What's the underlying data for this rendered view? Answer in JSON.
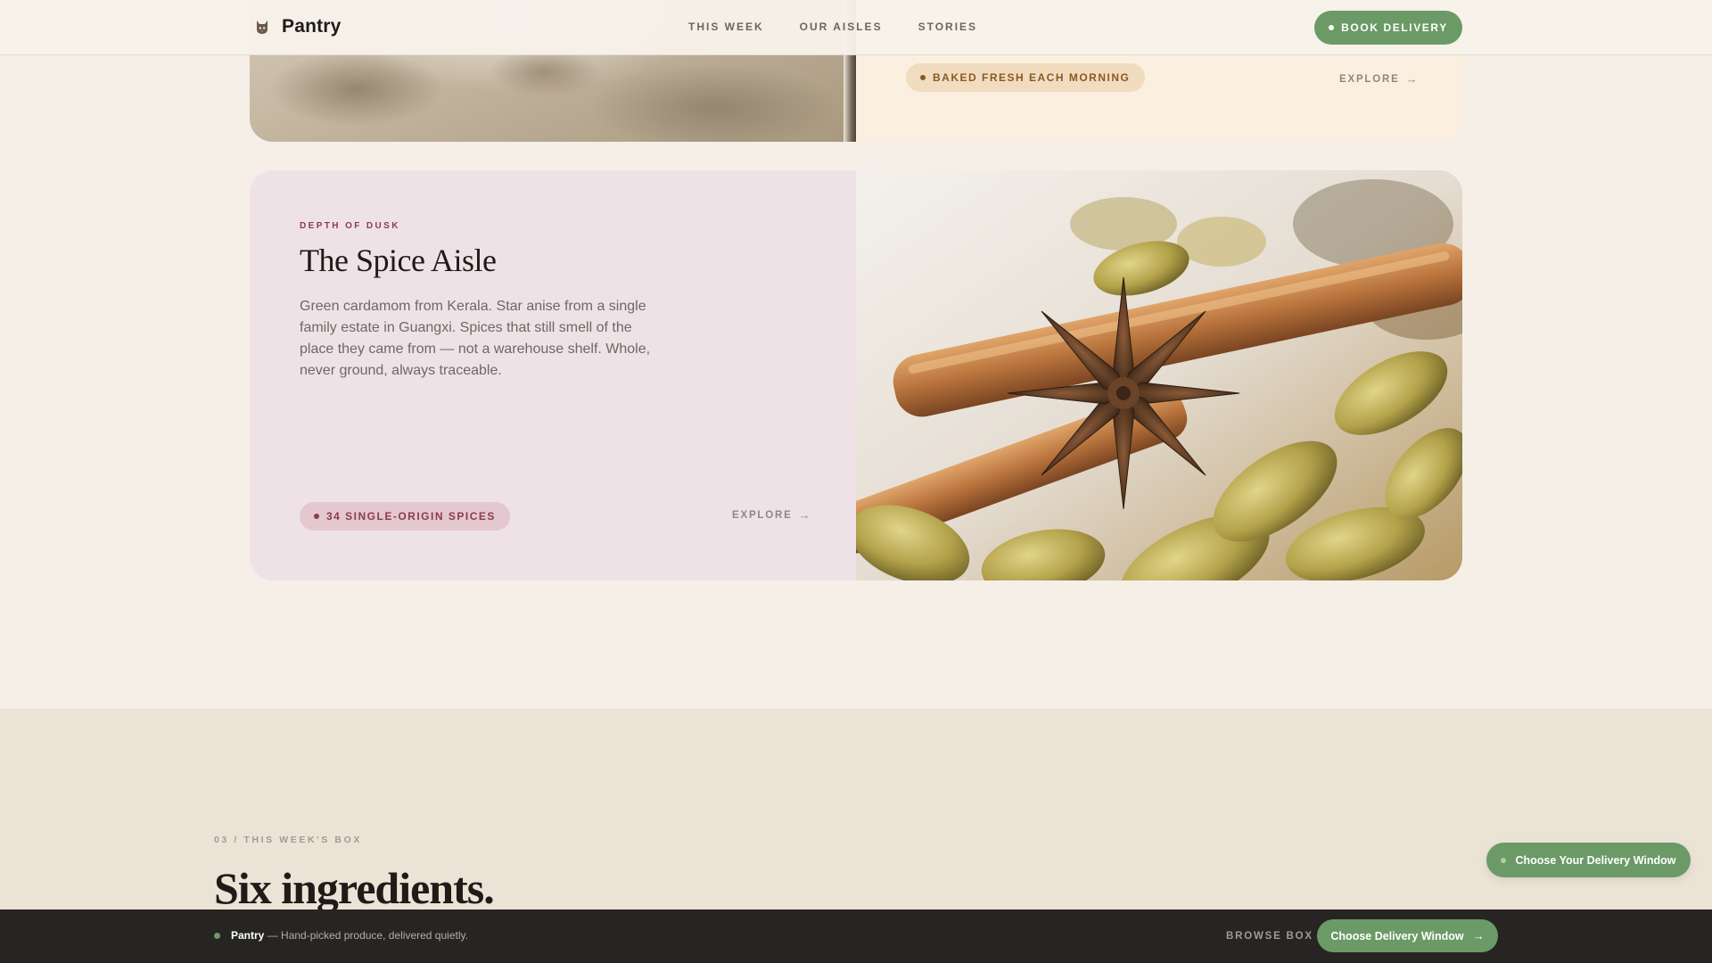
{
  "header": {
    "brand": "Pantry",
    "nav": [
      "THIS WEEK",
      "OUR AISLES",
      "STORIES"
    ],
    "book_label": "BOOK DELIVERY"
  },
  "top_card": {
    "pill": "BAKED FRESH EACH MORNING",
    "explore": "EXPLORE"
  },
  "spice_card": {
    "eyebrow": "DEPTH OF DUSK",
    "title": "The Spice Aisle",
    "description": "Green cardamom from Kerala. Star anise from a single family estate in Guangxi. Spices that still smell of the place they came from — not a warehouse shelf. Whole, never ground, always traceable.",
    "pill": "34 SINGLE-ORIGIN SPICES",
    "explore": "EXPLORE"
  },
  "box_section": {
    "eyebrow": "03 / THIS WEEK'S BOX",
    "title": "Six ingredients."
  },
  "floating_cta": "Choose Your Delivery Window",
  "bottom_bar": {
    "brand": "Pantry",
    "tagline": "— Hand-picked produce, delivered quietly.",
    "browse": "BROWSE BOX",
    "cta": "Choose Delivery Window"
  },
  "colors": {
    "accent_green": "#6b9a66",
    "spice_accent": "#8c3b4e",
    "bakery_accent": "#8a5a22",
    "page_bg": "#f5efe8"
  }
}
